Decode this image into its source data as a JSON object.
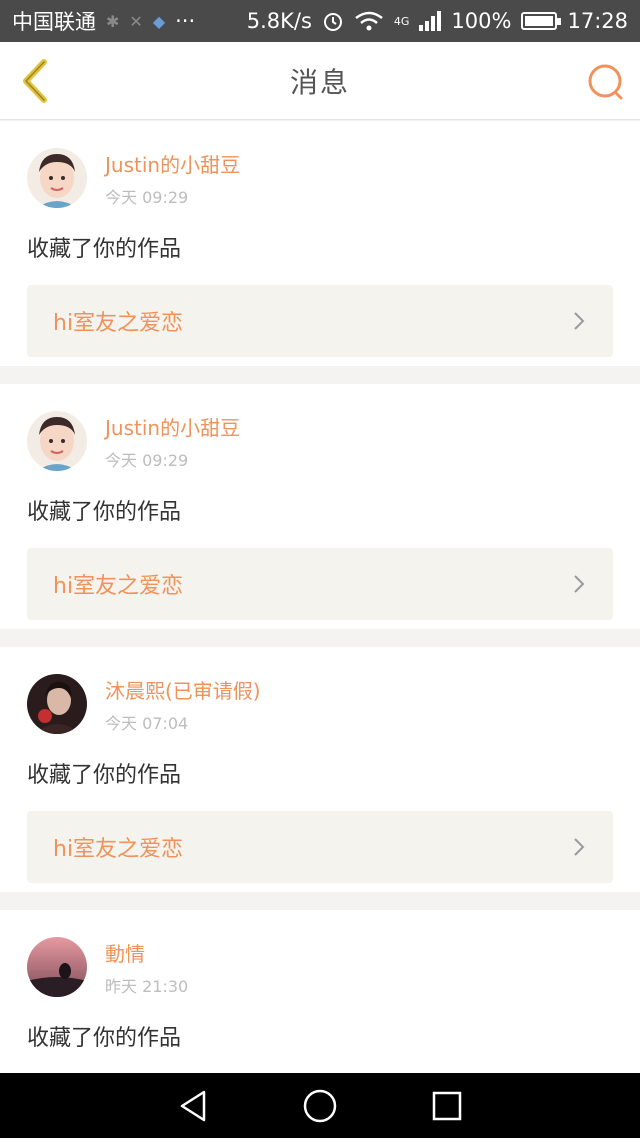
{
  "status_bar": {
    "carrier": "中国联通",
    "net_speed": "5.8K/s",
    "network": "4G",
    "battery": "100%",
    "battery_level": 1.0,
    "time": "17:28",
    "icons": [
      "bluetooth-icon",
      "sim-icon",
      "app-notification-icon",
      "more-dots-icon",
      "alarm-icon",
      "wifi-icon",
      "signal-icon",
      "battery-icon"
    ]
  },
  "header": {
    "title": "消息",
    "back_icon": "back-chevron-icon",
    "search_icon": "search-icon"
  },
  "notifications": [
    {
      "username": "Justin的小甜豆",
      "time": "今天 09:29",
      "action": "收藏了你的作品",
      "work": "hi室友之爱恋",
      "avatar": "avatar-1"
    },
    {
      "username": "Justin的小甜豆",
      "time": "今天 09:29",
      "action": "收藏了你的作品",
      "work": "hi室友之爱恋",
      "avatar": "avatar-1"
    },
    {
      "username": "沐晨熙(已审请假)",
      "time": "今天 07:04",
      "action": "收藏了你的作品",
      "work": "hi室友之爱恋",
      "avatar": "avatar-2"
    },
    {
      "username": "動情",
      "time": "昨天 21:30",
      "action": "收藏了你的作品",
      "work": "",
      "avatar": "avatar-3"
    }
  ],
  "colors": {
    "accent": "#f0925a",
    "back_icon": "#e3c33c",
    "status_bar_bg": "#4a4a4a"
  },
  "system_nav": [
    "back-triangle-icon",
    "home-circle-icon",
    "recents-square-icon"
  ]
}
